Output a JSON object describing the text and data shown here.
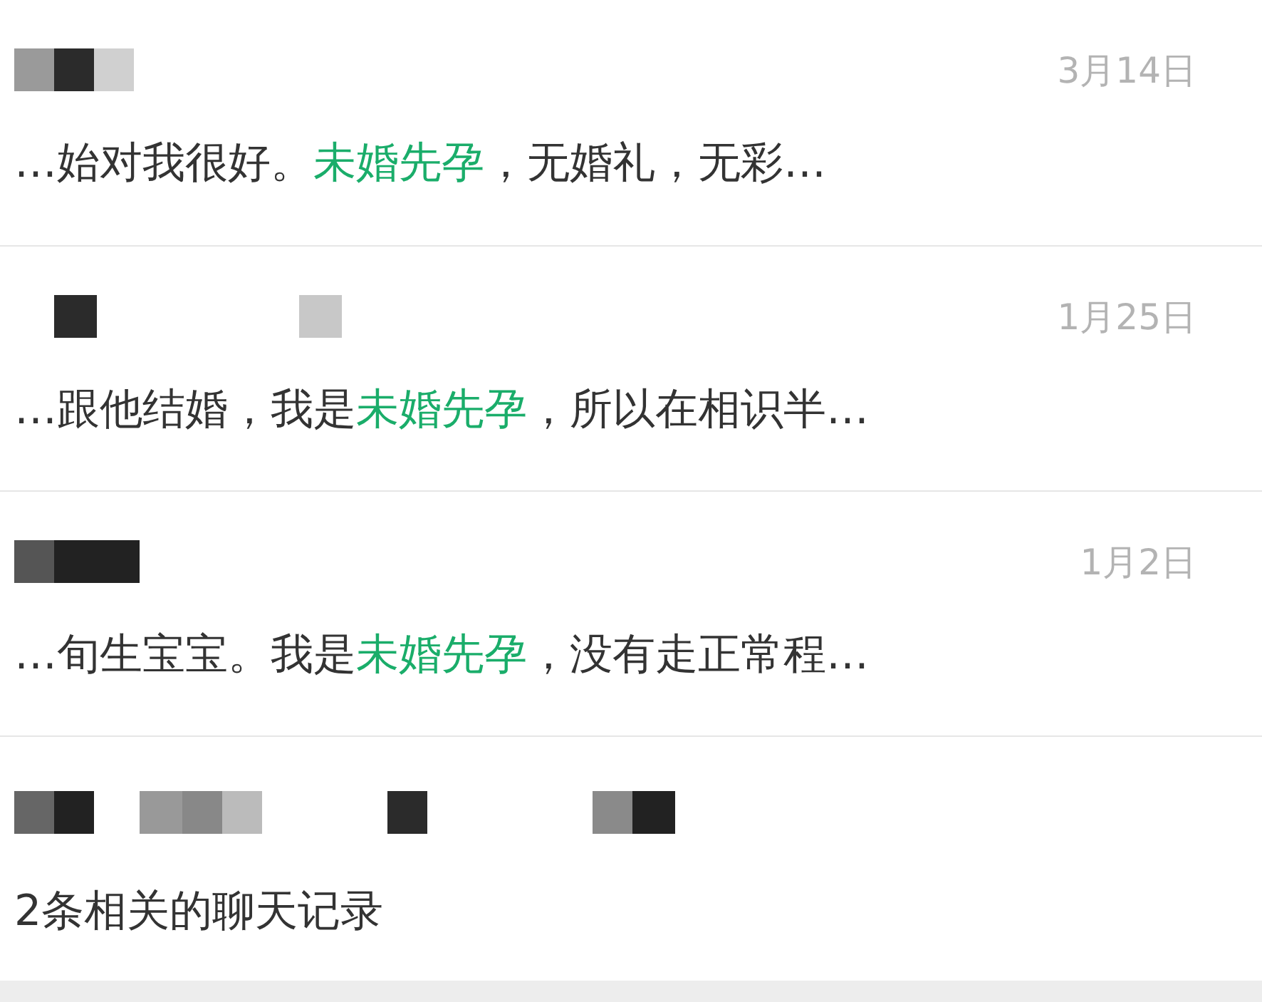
{
  "results": [
    {
      "date": "3月14日",
      "snippet": [
        {
          "text": "…始对我很好。",
          "highlighted": false
        },
        {
          "text": "未婚先孕",
          "highlighted": true
        },
        {
          "text": "，无婚礼，无彩…",
          "highlighted": false
        }
      ]
    },
    {
      "date": "1月25日",
      "snippet": [
        {
          "text": "…跟他结婚，我是",
          "highlighted": false
        },
        {
          "text": "未婚先孕",
          "highlighted": true
        },
        {
          "text": "，所以在相识半…",
          "highlighted": false
        }
      ]
    },
    {
      "date": "1月2日",
      "snippet": [
        {
          "text": "…旬生宝宝。我是",
          "highlighted": false
        },
        {
          "text": "未婚先孕",
          "highlighted": true
        },
        {
          "text": "，没有走正常程…",
          "highlighted": false
        }
      ]
    }
  ],
  "chat_group": {
    "summary": "2条相关的聊天记录"
  }
}
